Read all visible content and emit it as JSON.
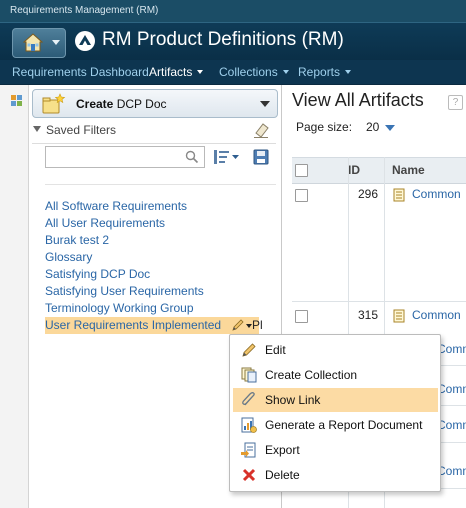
{
  "app": {
    "window_title": "Requirements Management (RM)"
  },
  "header": {
    "project_title": "RM Product Definitions (RM)",
    "home_icon": "home-icon",
    "project_icon": "rm-project-icon"
  },
  "nav": {
    "items": [
      {
        "label": "Requirements Dashboard",
        "caret": false,
        "active": false
      },
      {
        "label": "Artifacts",
        "caret": true,
        "active": true
      },
      {
        "label": "Collections",
        "caret": true,
        "active": false
      },
      {
        "label": "Reports",
        "caret": true,
        "active": false
      }
    ]
  },
  "sidebar": {
    "create_verb": "Create",
    "create_type": " DCP Doc",
    "saved_filters_label": "Saved Filters",
    "search": {
      "placeholder": "",
      "value": ""
    },
    "filters": [
      "All Software Requirements",
      "All User Requirements",
      "Burak test 2",
      "Glossary",
      "Satisfying DCP Doc",
      "Satisfying User Requirements",
      "Terminology Working Group",
      "User Requirements Implemented"
    ],
    "selected_filter_index": 7,
    "selected_tail": "Pl"
  },
  "main": {
    "title": "View All Artifacts",
    "help_glyph": "?",
    "page_size_label": "Page size:",
    "page_size_value": "20",
    "columns": [
      "ID",
      "Name"
    ],
    "rows": [
      {
        "id": "296",
        "name": "Common"
      },
      {
        "id": "315",
        "name": "Common"
      },
      {
        "id": "",
        "name": "Common"
      },
      {
        "id": "",
        "name": "Common"
      },
      {
        "id": "",
        "name": "Common"
      },
      {
        "id": "",
        "name": "Common"
      }
    ]
  },
  "context_menu": {
    "items": [
      {
        "label": "Edit",
        "icon": "pencil-icon"
      },
      {
        "label": "Create Collection",
        "icon": "collection-icon"
      },
      {
        "label": "Show Link",
        "icon": "paperclip-link-icon",
        "highlighted": true
      },
      {
        "label": "Generate a Report Document",
        "icon": "report-document-icon"
      },
      {
        "label": "Export",
        "icon": "export-icon"
      },
      {
        "label": "Delete",
        "icon": "delete-x-icon"
      }
    ]
  },
  "colors": {
    "header_bg": "#0e3b57",
    "nav_link": "#9fd0ec",
    "link": "#2a66a6",
    "selection": "#fbd89a",
    "menu_highlight": "#fcdba4",
    "delete_red": "#d8322a"
  }
}
